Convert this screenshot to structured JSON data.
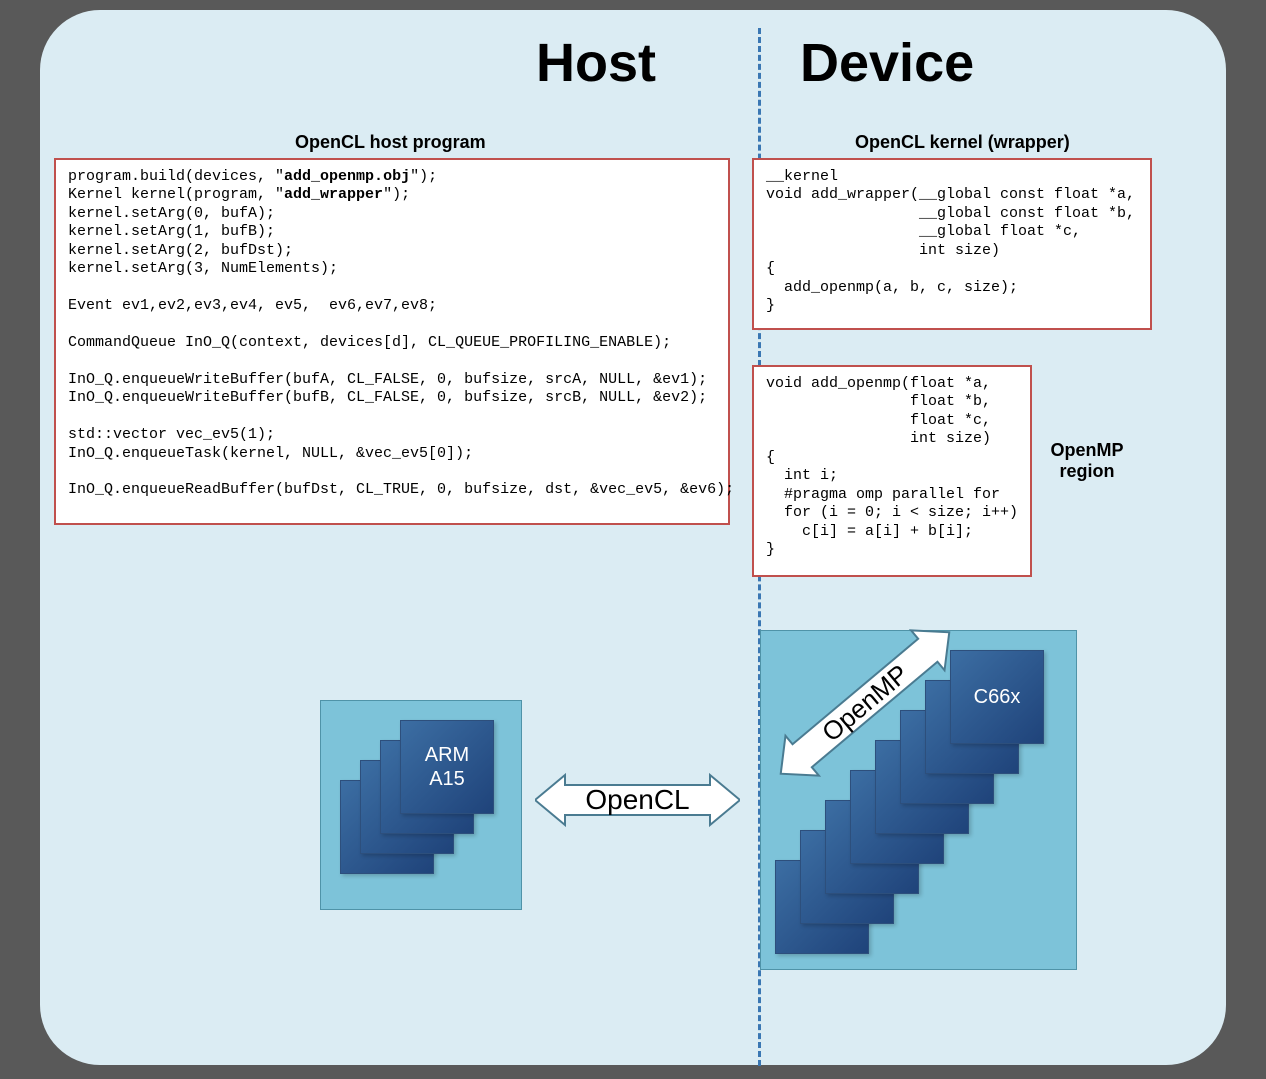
{
  "titles": {
    "host": "Host",
    "device": "Device"
  },
  "labels": {
    "host_program": "OpenCL host program",
    "kernel_wrapper": "OpenCL kernel (wrapper)",
    "openmp_region": "OpenMP\nregion",
    "arrow_opencl": "OpenCL",
    "arrow_openmp": "OpenMP",
    "arm_tile": "ARM\nA15",
    "c66x_tile": "C66x"
  },
  "code": {
    "host": "program.build(devices, \"<b>add_openmp.obj</b>\");\nKernel kernel(program, \"<b>add_wrapper</b>\");\nkernel.setArg(0, bufA);\nkernel.setArg(1, bufB);\nkernel.setArg(2, bufDst);\nkernel.setArg(3, NumElements);\n\nEvent ev1,ev2,ev3,ev4, ev5,  ev6,ev7,ev8;\n\nCommandQueue InO_Q(context, devices[d], CL_QUEUE_PROFILING_ENABLE);\n\nInO_Q.enqueueWriteBuffer(bufA, CL_FALSE, 0, bufsize, srcA, NULL, &ev1);\nInO_Q.enqueueWriteBuffer(bufB, CL_FALSE, 0, bufsize, srcB, NULL, &ev2);\n\nstd::vector<Event> vec_ev5(1);\nInO_Q.enqueueTask(kernel, NULL, &vec_ev5[0]);\n\nInO_Q.enqueueReadBuffer(bufDst, CL_TRUE, 0, bufsize, dst, &vec_ev5, &ev6);",
    "wrapper": "__kernel\nvoid add_wrapper(__global const float *a,\n                 __global const float *b,\n                 __global float *c,\n                 int size)\n{\n  add_openmp(a, b, c, size);\n}",
    "openmp": "void add_openmp(float *a,\n                float *b,\n                float *c,\n                int size)\n{\n  int i;\n  #pragma omp parallel for\n  for (i = 0; i < size; i++)\n    c[i] = a[i] + b[i];\n}"
  },
  "colors": {
    "bg": "#595959",
    "panel": "#dbecf3",
    "border": "#c0504d",
    "tile_area": "#7dc3d9"
  }
}
